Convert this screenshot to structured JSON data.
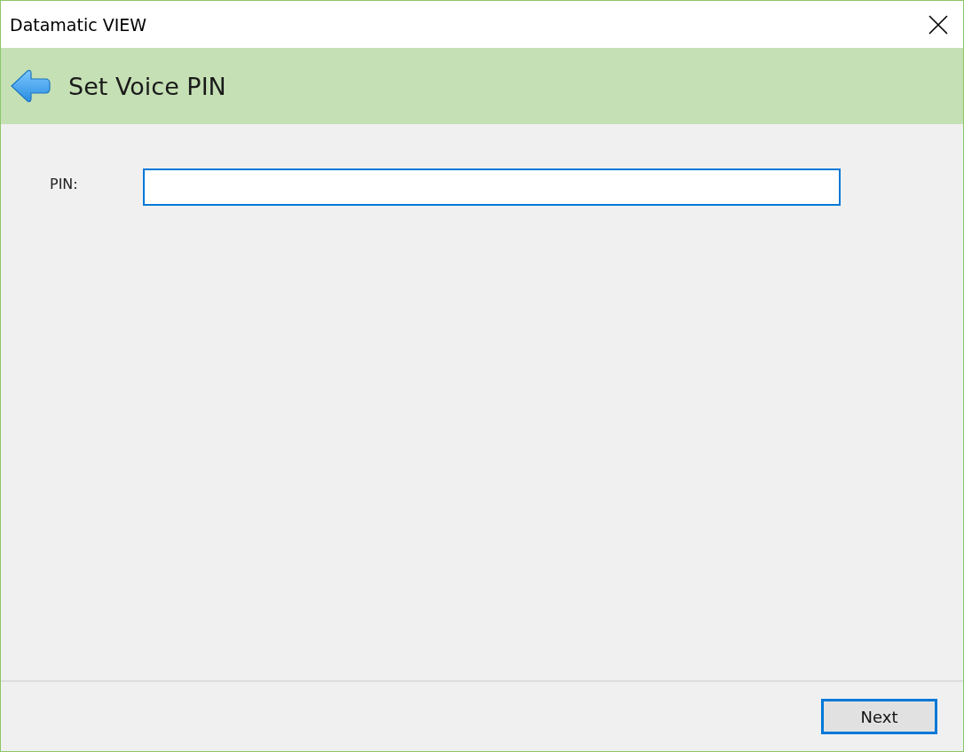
{
  "window": {
    "title": "Datamatic VIEW"
  },
  "header": {
    "title": "Set Voice PIN"
  },
  "form": {
    "label": "PIN:"
  },
  "buttons": [
    "Next"
  ]
}
